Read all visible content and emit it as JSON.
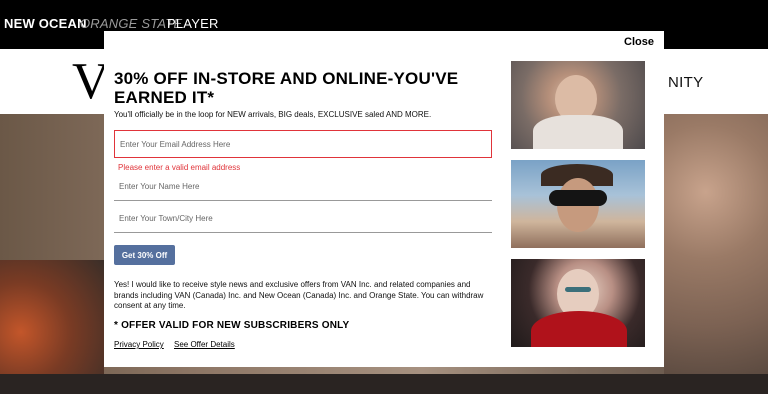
{
  "brands": [
    "NEW OCEAN",
    "ORANGE STATE",
    "PLAYER"
  ],
  "site": {
    "logo_letter": "V",
    "nav_right": "NITY"
  },
  "modal": {
    "close_label": "Close",
    "title": "30% OFF IN-STORE AND ONLINE-YOU'VE EARNED IT*",
    "subtitle": "You'll officially be in the loop for NEW arrivals, BIG deals, EXCLUSIVE saled AND MORE.",
    "email_placeholder": "Enter Your Email Address Here",
    "email_error": "Please enter a valid email address",
    "name_placeholder": "Enter Your Name Here",
    "town_placeholder": "Enter Your Town/City Here",
    "submit_label": "Get 30% Off",
    "consent": "Yes! I would like to receive style news and exclusive offers from VAN Inc. and related companies and brands including VAN (Canada) Inc. and New Ocean (Canada) Inc. and Orange State. You can withdraw consent at any time.",
    "offer_note": "* OFFER VALID FOR NEW SUBSCRIBERS ONLY",
    "privacy_link": "Privacy Policy",
    "details_link": "See Offer Details"
  },
  "colors": {
    "accent_button": "#55709e",
    "error": "#e0343a"
  }
}
